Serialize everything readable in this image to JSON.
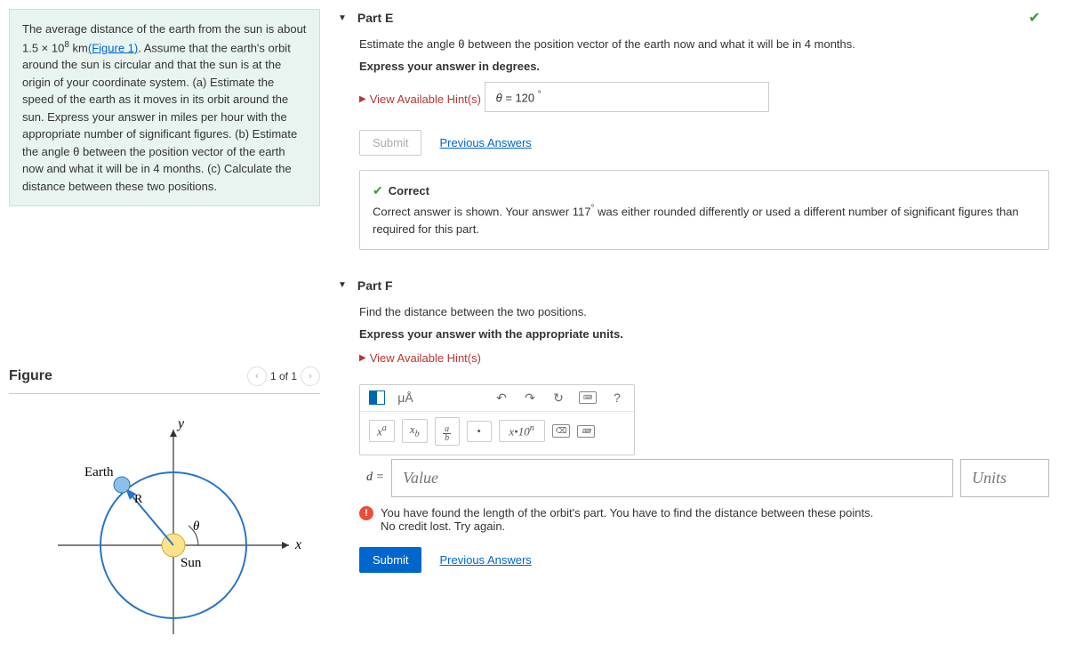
{
  "problem": {
    "intro": "The average distance of the earth from the sun is about ",
    "value": "1.5 × 10",
    "exp": "8",
    "unit": " km",
    "figlink": "(Figure 1)",
    "rest": ". Assume that the earth's orbit around the sun is circular and that the sun is at the origin of your coordinate system. (a) Estimate the speed of the earth as it moves in its orbit around the sun. Express your answer in miles per hour with the appropriate number of significant figures. (b) Estimate the angle θ between the position vector of the earth now and what it will be in 4 months. (c) Calculate the distance between these two positions."
  },
  "figure": {
    "title": "Figure",
    "counter": "1 of 1",
    "labels": {
      "earth": "Earth",
      "sun": "Sun",
      "r": "R",
      "theta": "θ",
      "x": "x",
      "y": "y"
    }
  },
  "partE": {
    "title": "Part E",
    "instr1": "Estimate the angle θ between the position vector of the earth now and what it will be in 4 months.",
    "instr2": "Express your answer in degrees.",
    "hints": "View Available Hint(s)",
    "answer_prefix": "θ = ",
    "answer_value": "120",
    "answer_unit": "°",
    "submit": "Submit",
    "prev": "Previous Answers",
    "fb_title": "Correct",
    "fb_body_a": "Correct answer is shown. Your answer ",
    "fb_val": "117",
    "fb_deg": "°",
    "fb_body_b": " was either rounded differently or used a different number of significant figures than required for this part."
  },
  "partF": {
    "title": "Part F",
    "instr1": "Find the distance between the two positions.",
    "instr2": "Express your answer with the appropriate units.",
    "hints": "View Available Hint(s)",
    "toolbar": {
      "units": "μÅ",
      "help": "?"
    },
    "row2": {
      "xa": "x",
      "xa_sup": "a",
      "xb": "x",
      "xb_sub": "b",
      "dot": "•",
      "sci": "x•10",
      "sci_sup": "n"
    },
    "d_label": "d =",
    "value_ph": "Value",
    "units_ph": "Units",
    "err1": "You have found the length of the orbit's part. You have to find the distance between these points.",
    "err2": "No credit lost. Try again.",
    "submit": "Submit",
    "prev": "Previous Answers"
  }
}
